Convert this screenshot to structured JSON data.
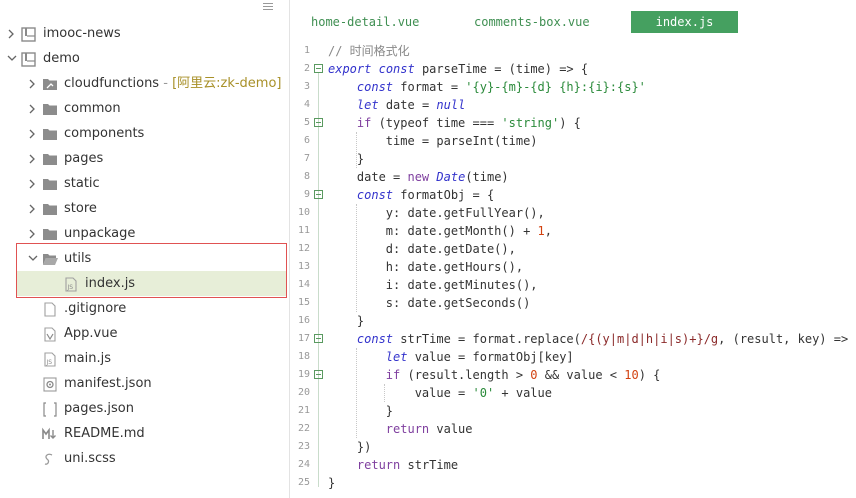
{
  "sidebar": {
    "items": [
      {
        "label": "imooc-news",
        "type": "project",
        "depth": 0,
        "expanded": false
      },
      {
        "label": "demo",
        "type": "project",
        "depth": 0,
        "expanded": true
      },
      {
        "label": "cloudfunctions",
        "type": "cloud-folder",
        "depth": 1,
        "expanded": false,
        "sep": " - ",
        "suffix": "[阿里云:zk-demo]"
      },
      {
        "label": "common",
        "type": "folder",
        "depth": 1,
        "expanded": false
      },
      {
        "label": "components",
        "type": "folder",
        "depth": 1,
        "expanded": false
      },
      {
        "label": "pages",
        "type": "folder",
        "depth": 1,
        "expanded": false
      },
      {
        "label": "static",
        "type": "folder",
        "depth": 1,
        "expanded": false
      },
      {
        "label": "store",
        "type": "folder",
        "depth": 1,
        "expanded": false
      },
      {
        "label": "unpackage",
        "type": "folder",
        "depth": 1,
        "expanded": false
      },
      {
        "label": "utils",
        "type": "folder",
        "depth": 1,
        "expanded": true
      },
      {
        "label": "index.js",
        "type": "js-file",
        "depth": 2,
        "selected": true
      },
      {
        "label": ".gitignore",
        "type": "file",
        "depth": 1
      },
      {
        "label": "App.vue",
        "type": "vue-file",
        "depth": 1
      },
      {
        "label": "main.js",
        "type": "js-file",
        "depth": 1
      },
      {
        "label": "manifest.json",
        "type": "manifest-file",
        "depth": 1
      },
      {
        "label": "pages.json",
        "type": "json-file",
        "depth": 1
      },
      {
        "label": "README.md",
        "type": "markdown-file",
        "depth": 1
      },
      {
        "label": "uni.scss",
        "type": "scss-file",
        "depth": 1
      }
    ]
  },
  "editor": {
    "tabs": [
      {
        "label": "home-detail.vue",
        "active": false
      },
      {
        "label": "comments-box.vue",
        "active": false
      },
      {
        "label": "index.js",
        "active": true
      }
    ],
    "lines": [
      {
        "n": "1",
        "fold": false,
        "tokens": [
          [
            "cmt",
            "// 时间格式化"
          ]
        ]
      },
      {
        "n": "2",
        "fold": true,
        "tokens": [
          [
            "kw",
            "export"
          ],
          [
            "",
            " "
          ],
          [
            "kw",
            "const"
          ],
          [
            "",
            " parseTime = (time) => {"
          ]
        ]
      },
      {
        "n": "3",
        "fold": false,
        "tokens": [
          [
            "",
            "    "
          ],
          [
            "kw",
            "const"
          ],
          [
            "",
            " format = "
          ],
          [
            "str",
            "'{y}-{m}-{d} {h}:{i}:{s}'"
          ]
        ]
      },
      {
        "n": "4",
        "fold": false,
        "tokens": [
          [
            "",
            "    "
          ],
          [
            "kw",
            "let"
          ],
          [
            "",
            " date = "
          ],
          [
            "kw",
            "null"
          ]
        ]
      },
      {
        "n": "5",
        "fold": true,
        "tokens": [
          [
            "",
            "    "
          ],
          [
            "kw2",
            "if"
          ],
          [
            "",
            " (typeof time === "
          ],
          [
            "str",
            "'string'"
          ],
          [
            "",
            ") {"
          ]
        ]
      },
      {
        "n": "6",
        "fold": false,
        "tokens": [
          [
            "",
            "        time = parseInt(time)"
          ]
        ]
      },
      {
        "n": "7",
        "fold": false,
        "tokens": [
          [
            "",
            "    }"
          ]
        ]
      },
      {
        "n": "8",
        "fold": false,
        "tokens": [
          [
            "",
            "    date = "
          ],
          [
            "kw2",
            "new"
          ],
          [
            "",
            " "
          ],
          [
            "cls",
            "Date"
          ],
          [
            "",
            "(time)"
          ]
        ]
      },
      {
        "n": "9",
        "fold": true,
        "tokens": [
          [
            "",
            "    "
          ],
          [
            "kw",
            "const"
          ],
          [
            "",
            " formatObj = {"
          ]
        ]
      },
      {
        "n": "10",
        "fold": false,
        "tokens": [
          [
            "",
            "        y: date.getFullYear(),"
          ]
        ]
      },
      {
        "n": "11",
        "fold": false,
        "tokens": [
          [
            "",
            "        m: date.getMonth() + "
          ],
          [
            "num",
            "1"
          ],
          [
            "",
            ","
          ]
        ]
      },
      {
        "n": "12",
        "fold": false,
        "tokens": [
          [
            "",
            "        d: date.getDate(),"
          ]
        ]
      },
      {
        "n": "13",
        "fold": false,
        "tokens": [
          [
            "",
            "        h: date.getHours(),"
          ]
        ]
      },
      {
        "n": "14",
        "fold": false,
        "tokens": [
          [
            "",
            "        i: date.getMinutes(),"
          ]
        ]
      },
      {
        "n": "15",
        "fold": false,
        "tokens": [
          [
            "",
            "        s: date.getSeconds()"
          ]
        ]
      },
      {
        "n": "16",
        "fold": false,
        "tokens": [
          [
            "",
            "    }"
          ]
        ]
      },
      {
        "n": "17",
        "fold": true,
        "tokens": [
          [
            "",
            "    "
          ],
          [
            "kw",
            "const"
          ],
          [
            "",
            " strTime = format.replace("
          ],
          [
            "rgx",
            "/{(y|m|d|h|i|s)+}/g"
          ],
          [
            "",
            ", (result, key) => {"
          ]
        ]
      },
      {
        "n": "18",
        "fold": false,
        "tokens": [
          [
            "",
            "        "
          ],
          [
            "kw",
            "let"
          ],
          [
            "",
            " value = formatObj[key]"
          ]
        ]
      },
      {
        "n": "19",
        "fold": true,
        "tokens": [
          [
            "",
            "        "
          ],
          [
            "kw2",
            "if"
          ],
          [
            "",
            " (result.length > "
          ],
          [
            "num",
            "0"
          ],
          [
            "",
            " && value < "
          ],
          [
            "num",
            "10"
          ],
          [
            "",
            ") {"
          ]
        ]
      },
      {
        "n": "20",
        "fold": false,
        "tokens": [
          [
            "",
            "            value = "
          ],
          [
            "str",
            "'0'"
          ],
          [
            "",
            " + value"
          ]
        ]
      },
      {
        "n": "21",
        "fold": false,
        "tokens": [
          [
            "",
            "        }"
          ]
        ]
      },
      {
        "n": "22",
        "fold": false,
        "tokens": [
          [
            "",
            "        "
          ],
          [
            "kw2",
            "return"
          ],
          [
            "",
            " value"
          ]
        ]
      },
      {
        "n": "23",
        "fold": false,
        "tokens": [
          [
            "",
            "    })"
          ]
        ]
      },
      {
        "n": "24",
        "fold": false,
        "tokens": [
          [
            "",
            "    "
          ],
          [
            "kw2",
            "return"
          ],
          [
            "",
            " strTime"
          ]
        ]
      },
      {
        "n": "25",
        "fold": false,
        "tokens": [
          [
            "",
            "}"
          ]
        ]
      }
    ]
  },
  "colors": {
    "accent_green": "#45a060",
    "selection_bg": "#e7eed8",
    "highlight_border": "#e05252"
  }
}
